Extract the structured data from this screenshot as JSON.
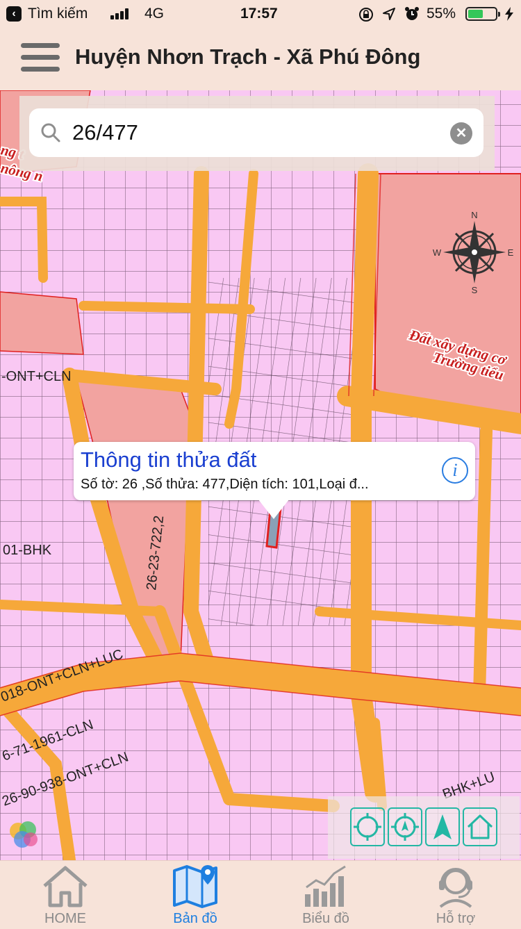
{
  "status_bar": {
    "back_label": "Tìm kiếm",
    "network": "4G",
    "time": "17:57",
    "battery_percent": "55%",
    "battery_level": 0.55
  },
  "header": {
    "title": "Huyện Nhơn Trạch - Xã Phú Đông"
  },
  "search": {
    "value": "26/477",
    "placeholder": ""
  },
  "map": {
    "compass_labels": {
      "n": "N",
      "s": "S",
      "e": "E",
      "w": "W"
    },
    "labels": {
      "ont_cln_left": "-ONT+CLN",
      "bhk": "01-BHK",
      "vertical_code": "26-23-722,2",
      "ont_cln_luc": "018-ONT+CLN+LUC",
      "cln_1961": "6-71-1961-CLN",
      "ont_cln_938": "26-90-938-ONT+CLN",
      "school_1": "Đất xây dựng cơ",
      "school_2": "Trường tiểu",
      "bhk_luc": "BHK+LU",
      "partial_top": "ng t",
      "partial_top2": "nông n"
    },
    "colors": {
      "residential": "#f9c8f3",
      "road": "#f6a83a",
      "public_land": "#f2a3a0",
      "boundary": "#e02020"
    }
  },
  "popup": {
    "title": "Thông tin thửa đất",
    "subtitle": "Số tờ: 26 ,Số thửa: 477,Diện tích: 101,Loại đ..."
  },
  "tabs": [
    {
      "label": "HOME",
      "icon": "home-icon",
      "active": false
    },
    {
      "label": "Bản đồ",
      "icon": "map-icon",
      "active": true
    },
    {
      "label": "Biểu đồ",
      "icon": "chart-icon",
      "active": false
    },
    {
      "label": "Hỗ trợ",
      "icon": "support-icon",
      "active": false
    }
  ]
}
